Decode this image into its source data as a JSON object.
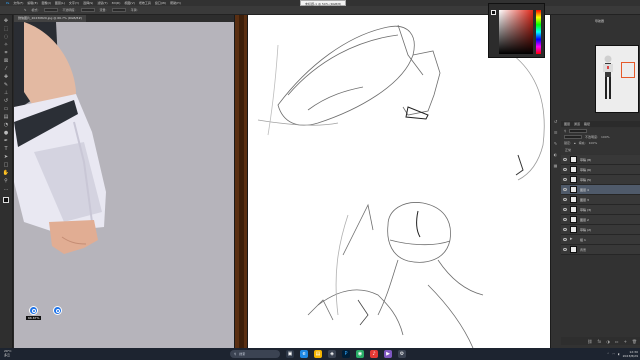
{
  "menu": [
    "文件(F)",
    "编辑(E)",
    "图像(I)",
    "图层(L)",
    "文字(Y)",
    "选择(S)",
    "滤镜(T)",
    "3D(D)",
    "视图(V)",
    "增效工具",
    "窗口(W)",
    "帮助(H)"
  ],
  "tool_options": [
    "模式:",
    "正常",
    "不透明度:",
    "100%",
    "流量:",
    "100%",
    "平滑:"
  ],
  "doc_tab": "微信图片_20230829.jpg @ 66.7% (RGB/8#)",
  "window_title": "未标题-1 @ 50% (RGB/8)",
  "zoom_tip": "66.67%",
  "navigator": {
    "title": "导航器"
  },
  "layers_panel": {
    "tabs": [
      "图层",
      "通道",
      "路径"
    ],
    "blend_mode": "正常",
    "opacity_label": "不透明度:",
    "opacity_value": "100%",
    "lock_label": "锁定:",
    "fill_label": "填充:",
    "fill_value": "100%",
    "layers": [
      {
        "name": "草稿 (8)",
        "type": "layer",
        "active": false
      },
      {
        "name": "草稿 (6)",
        "type": "layer",
        "active": false
      },
      {
        "name": "草稿 (5)",
        "type": "layer",
        "active": false
      },
      {
        "name": "图层 4",
        "type": "layer",
        "active": true
      },
      {
        "name": "图层 3",
        "type": "layer",
        "active": false
      },
      {
        "name": "草稿 (3)",
        "type": "layer",
        "active": false
      },
      {
        "name": "图层 2",
        "type": "layer",
        "active": false
      },
      {
        "name": "草稿 (2)",
        "type": "layer",
        "active": false
      },
      {
        "name": "组 1",
        "type": "folder",
        "active": false
      },
      {
        "name": "背景",
        "type": "layer",
        "active": false
      }
    ]
  },
  "taskbar": {
    "weather_temp": "29°C",
    "weather_desc": "多云",
    "search_placeholder": "搜索",
    "time": "12:30",
    "date": "2023/8/29"
  },
  "colors": {
    "accent_blue": "#1e73e8",
    "active_layer": "#4f5a6a",
    "nav_frame": "#e65a2a"
  }
}
